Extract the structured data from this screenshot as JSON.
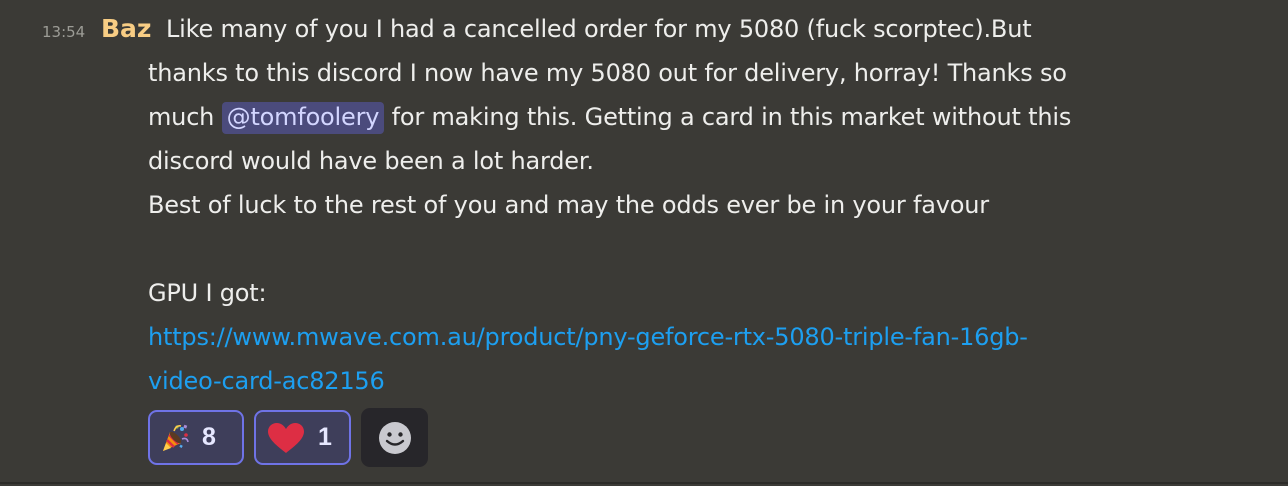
{
  "message": {
    "timestamp": "13:54",
    "author": "Baz",
    "lines": {
      "l1": "Like many of you I had a cancelled order for my 5080 (fuck scorptec).But",
      "l2": "thanks to this discord I now have my 5080 out for delivery, horray! Thanks so",
      "l3_pre": "much ",
      "mention": "@tomfoolery",
      "l3_post": " for making this. Getting a card in this market without this",
      "l4": "discord would have been a lot harder.",
      "l5": "Best of luck to the rest of you and may the odds ever be in your favour",
      "l7": "GPU I got:"
    },
    "link": {
      "line1": "https://www.mwave.com.au/product/pny-geforce-rtx-5080-triple-fan-16gb-",
      "line2": "video-card-ac82156"
    }
  },
  "reactions": [
    {
      "icon": "party-popper-icon",
      "count": "8"
    },
    {
      "icon": "red-heart-icon",
      "count": "1"
    }
  ],
  "add_reaction": {
    "icon": "smiley-face-icon"
  },
  "colors": {
    "background": "#3b3a36",
    "username": "#f8cd84",
    "link": "#1d9ff0",
    "mention_bg": "#4b4b7c",
    "reaction_border": "#6f73e6"
  }
}
